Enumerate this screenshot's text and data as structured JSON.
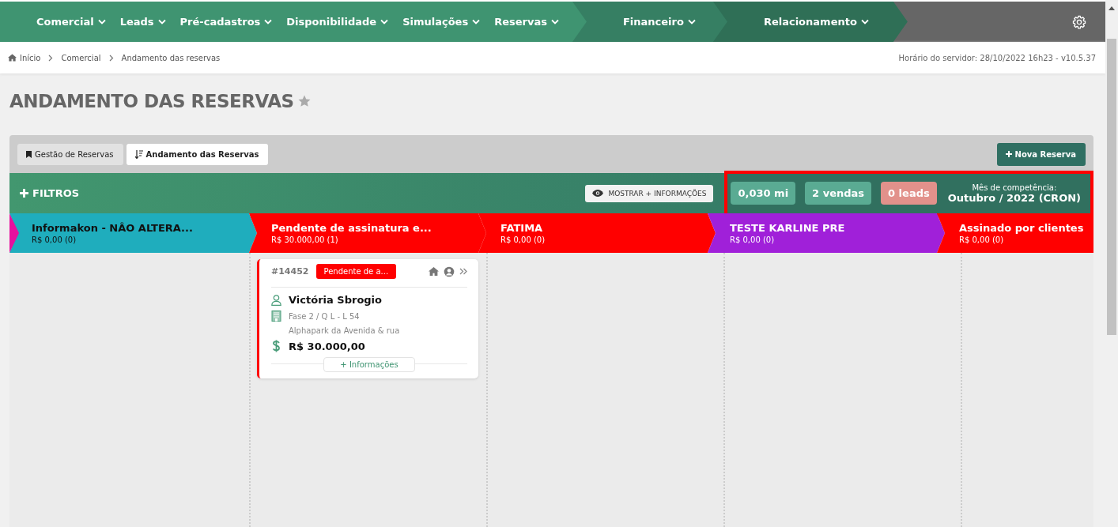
{
  "nav": {
    "sections": [
      {
        "color": "#3f9471",
        "items": [
          "Comercial",
          "Leads",
          "Pré-cadastros",
          "Disponibilidade",
          "Simulações",
          "Reservas"
        ]
      },
      {
        "color": "#367f63",
        "items": [
          "Financeiro"
        ]
      },
      {
        "color": "#2f6f56",
        "items": [
          "Relacionamento"
        ]
      }
    ]
  },
  "breadcrumb": [
    "Início",
    "Comercial",
    "Andamento das reservas"
  ],
  "server_time": "Horário do servidor: 28/10/2022 16h23 - v10.5.37",
  "page_title": "ANDAMENTO DAS RESERVAS",
  "tabs": [
    {
      "label": "Gestão de Reservas",
      "selected": false,
      "kind": "bookmark"
    },
    {
      "label": "Andamento das Reservas",
      "selected": true,
      "kind": "sort"
    }
  ],
  "new_button": "Nova Reserva",
  "filters_label": "FILTROS",
  "show_more_button": "MOSTRAR + INFORMAÇÕES",
  "stats": [
    {
      "value": "0,030 mi",
      "color": "#5aab93"
    },
    {
      "value": "2 vendas",
      "color": "#5aab93"
    },
    {
      "value": "0 leads",
      "color": "#e2918b"
    }
  ],
  "period": {
    "label": "Mês de competência:",
    "value": "Outubro / 2022 (CRON)"
  },
  "columns": [
    {
      "title": "Informakon - NÂO ALTERA...",
      "total": "R$ 0,00 (0)",
      "color": "#1fadbd"
    },
    {
      "title": "Pendente de assinatura e...",
      "total": "R$ 30.000,00 (1)",
      "color": "#ff0000",
      "cards": [
        {
          "number": "#14452",
          "status": "Pendente de a...",
          "name": "Victória Sbrogio",
          "unit": "Fase 2 / Q L - L 54",
          "project": "Alphapark da Avenida & rua",
          "value": "R$ 30.000,00",
          "more": "+ Informações"
        }
      ]
    },
    {
      "title": "FATIMA",
      "total": "R$ 0,00 (0)",
      "color": "#ff0000"
    },
    {
      "title": "TESTE KARLINE PRE",
      "total": "R$ 0,00 (0)",
      "color": "#a020d9"
    },
    {
      "title": "Assinado por clientes",
      "total": "R$ 0,00 (0)",
      "color": "#ff0000"
    }
  ]
}
